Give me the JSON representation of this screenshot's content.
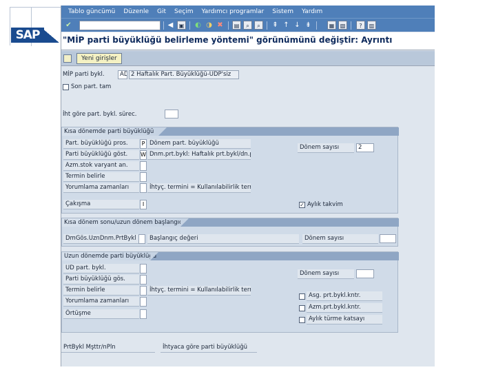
{
  "menu": [
    "Tablo güncümü",
    "Düzenle",
    "Git",
    "Seçim",
    "Yardımcı programlar",
    "Sistem",
    "Yardım"
  ],
  "title": "\"MİP parti büyüklüğü belirleme yöntemi\" görünümünü değiştir: Ayrıntı",
  "app_button": "Yeni girişler",
  "logo": "SAP",
  "header_fields": {
    "mip_label": "MİP parti bykl.",
    "mip_code": "AD",
    "mip_desc": "2 Haftalık Part. Büyüklüğü-UDP'siz",
    "son_part": "Son part. tam",
    "iht_label": "İht göre part. bykl. sürec.",
    "iht_value": ""
  },
  "short_term": {
    "title": "Kısa dönemde parti büyüklüğü",
    "rows": [
      {
        "label": "Part. büyüklüğü pros.",
        "code": "P",
        "desc": "Dönem part. büyüklüğü"
      },
      {
        "label": "Parti büyüklüğü göst.",
        "code": "W",
        "desc": "Dnm.prt.bykl: Haftalık prt.bykl/dn.prt.d"
      },
      {
        "label": "Azm.stok varyant an.",
        "code": "",
        "desc": ""
      },
      {
        "label": "Termin belirle",
        "code": "",
        "desc": ""
      },
      {
        "label": "Yorumlama zamanları",
        "code": "",
        "desc": "İhtyç. termini = Kullanılabilirlik termini"
      },
      {
        "label": "Çakışma",
        "code": "I",
        "desc": ""
      }
    ],
    "donem_label": "Dönem sayısı",
    "donem_value": "2",
    "aylik_label": "Aylık takvim"
  },
  "rule_section": {
    "title": "Kısa dönem sonu/uzun dönem başlangıcı",
    "col1": "DmGös.UznDnm.PrtBykl",
    "col2": "Başlangıç değeri",
    "col3": "Dönem sayısı"
  },
  "long_term": {
    "title": "Uzun dönemde parti büyüklüğü",
    "rows": [
      {
        "label": "UD part. bykl.",
        "desc": ""
      },
      {
        "label": "Parti büyüklüğü gös.",
        "desc": ""
      },
      {
        "label": "Termin belirle",
        "desc": "İhtyç. termini = Kullanılabilirlik termini"
      },
      {
        "label": "Yorumlama zamanları",
        "desc": ""
      },
      {
        "label": "Örtüşme",
        "desc": ""
      }
    ],
    "donem_label": "Dönem sayısı",
    "checks": [
      "Asg. prt.bykl.kntr.",
      "Azm.prt.bykl.kntr.",
      "Aylık türme katsayı"
    ]
  },
  "footer": {
    "left": "PrtBykl Mşttr/nPln",
    "right": "İhtyaca göre parti büyüklüğü"
  }
}
